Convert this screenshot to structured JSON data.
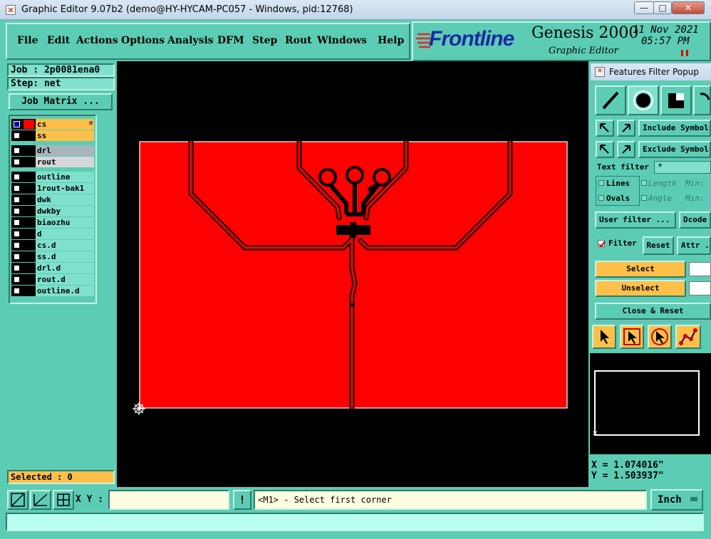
{
  "window": {
    "title": "Graphic Editor 9.07b2 (demo@HY-HYCAM-PC057 - Windows, pid:12768)",
    "minimize": "—",
    "maximize": "□",
    "close": "✕"
  },
  "menu": {
    "items": [
      "File",
      "Edit",
      "Actions",
      "Options",
      "Analysis",
      "DFM",
      "Step",
      "Rout",
      "Windows",
      "Help"
    ]
  },
  "brand": {
    "logo": "Frontline",
    "product": "Genesis 2000",
    "subtitle": "Graphic Editor",
    "date": "11 Nov 2021",
    "time": "05:57 PM"
  },
  "job": {
    "job_label": "Job : 2p0081ena0",
    "step_label": "Step: net",
    "matrix_button": "Job Matrix ..."
  },
  "layers": [
    {
      "name": "cs",
      "color": "#ff0000",
      "selected": true,
      "style": "work"
    },
    {
      "name": "ss",
      "color": "#000000",
      "selected": false,
      "style": "work"
    },
    {
      "name": "drl",
      "color": "#000000",
      "selected": false,
      "style": "drill"
    },
    {
      "name": "rout",
      "color": "#000000",
      "selected": false,
      "style": "rout"
    },
    {
      "name": "outline",
      "color": "#000000",
      "selected": false,
      "style": "misc"
    },
    {
      "name": "1rout-bak1",
      "color": "#000000",
      "selected": false,
      "style": "misc"
    },
    {
      "name": "dwk",
      "color": "#000000",
      "selected": false,
      "style": "misc"
    },
    {
      "name": "dwkby",
      "color": "#000000",
      "selected": false,
      "style": "misc"
    },
    {
      "name": "biaozhu",
      "color": "#000000",
      "selected": false,
      "style": "misc"
    },
    {
      "name": "d",
      "color": "#000000",
      "selected": false,
      "style": "misc"
    },
    {
      "name": "cs.d",
      "color": "#000000",
      "selected": false,
      "style": "misc"
    },
    {
      "name": "ss.d",
      "color": "#000000",
      "selected": false,
      "style": "misc"
    },
    {
      "name": "drl.d",
      "color": "#000000",
      "selected": false,
      "style": "misc"
    },
    {
      "name": "rout.d",
      "color": "#000000",
      "selected": false,
      "style": "misc"
    },
    {
      "name": "outline.d",
      "color": "#000000",
      "selected": false,
      "style": "misc"
    }
  ],
  "selected_count": "Selected : 0",
  "filter_popup": {
    "title": "Features Filter Popup",
    "include_symbols": "Include Symbols",
    "exclude_symbols": "Exclude Symbols",
    "text_filter_label": "Text filter",
    "text_filter_value": "*",
    "lines": "Lines",
    "ovals": "Ovals",
    "length": "Length",
    "angle": "Angle",
    "min1": "Min:",
    "min2": "Min:",
    "user_filter": "User filter ...",
    "dcode": "Dcode",
    "filter": "Filter",
    "reset": "Reset",
    "attr": "Attr ...",
    "select": "Select",
    "unselect": "Unselect",
    "close_reset": "Close & Reset"
  },
  "coords": {
    "x": "X = 1.074016\"",
    "y": "Y = 1.503937\""
  },
  "status": {
    "xy_label": "X Y :",
    "xy_value": "",
    "message": "<M1> - Select first corner",
    "units": "Inch"
  },
  "colors": {
    "panel": "#5ccdb4",
    "copper": "#ff0000",
    "highlight": "#ffc04a"
  }
}
